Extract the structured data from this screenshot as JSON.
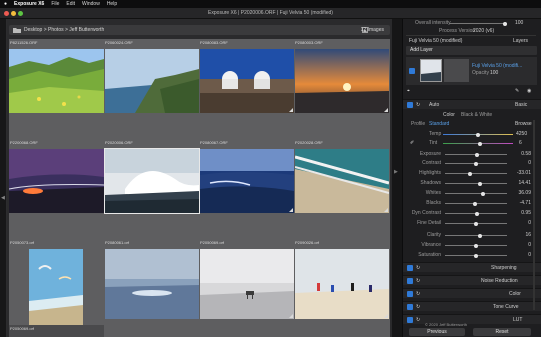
{
  "menubar": {
    "apple": "",
    "app": "Exposure X6",
    "items": [
      "File",
      "Edit",
      "Window",
      "Help"
    ]
  },
  "window_title": "Exposure X6 | P2020006.ORF | Fuji Velvia 50 (modified)",
  "browser": {
    "breadcrumb": "Desktop > Photos > Jeff Butterworth",
    "count": "12 Images",
    "cells": [
      {
        "label": "P8211526.ORF"
      },
      {
        "label": "P2060024.ORF"
      },
      {
        "label": "P2080083.ORF"
      },
      {
        "label": "P2080003.ORF"
      },
      {
        "label": "P2200068.ORF"
      },
      {
        "label": "P2020006.ORF"
      },
      {
        "label": "P2080067.ORF"
      },
      {
        "label": "P2020028.ORF"
      },
      {
        "label": "P2050073.orf"
      },
      {
        "label": "P2080061.orf"
      },
      {
        "label": "P2050069.orf"
      },
      {
        "label": "P2090026.orf"
      }
    ],
    "bottom_label": "P2050069.orf"
  },
  "panel": {
    "overall_intensity_label": "Overall intensity",
    "overall_intensity_value": "100",
    "process_version_label": "Process Version",
    "process_version_value": "2020 (v6)",
    "add_layer": "Add Layer",
    "layer_name": "Fuji Velvia 50 (modified)",
    "layers_label": "Layers",
    "layer_preset": "Fuji Velvia 50 (modifi...",
    "opacity_label": "Opacity",
    "opacity_value": "100",
    "basic_label": "Basic",
    "auto_label": "Auto",
    "tab_color": "Color",
    "tab_bw": "Black & White",
    "profile_label": "Profile",
    "profile_value": "Standard",
    "browse_label": "Browse",
    "temp_label": "Temp",
    "temp_value": "4250",
    "tint_label": "Tint",
    "tint_value": "6",
    "sliders": [
      {
        "label": "Exposure",
        "value": "0.58",
        "pos": 0.52
      },
      {
        "label": "Contrast",
        "value": "0",
        "pos": 0.5
      },
      {
        "label": "Highlights",
        "value": "-33.01",
        "pos": 0.4
      },
      {
        "label": "Shadows",
        "value": "14.41",
        "pos": 0.56
      },
      {
        "label": "Whites",
        "value": "36.09",
        "pos": 0.62
      },
      {
        "label": "Blacks",
        "value": "-4.71",
        "pos": 0.48
      },
      {
        "label": "Dyn Contrast",
        "value": "0.95",
        "pos": 0.52
      },
      {
        "label": "Fine Detail",
        "value": "0",
        "pos": 0.5
      },
      {
        "label": "Clarity",
        "value": "16",
        "pos": 0.57
      },
      {
        "label": "Vibrance",
        "value": "0",
        "pos": 0.5
      },
      {
        "label": "Saturation",
        "value": "0",
        "pos": 0.5
      }
    ],
    "sections": [
      "Sharpening",
      "Noise Reduction",
      "Color",
      "Tone Curve",
      "LUT"
    ],
    "copyright": "© 2020 Jeff Butterworth",
    "previous_button": "Previous",
    "reset_button": "Reset"
  },
  "colors": {
    "accent": "#2f7ad8",
    "grid_bg": "#5e5e60"
  }
}
